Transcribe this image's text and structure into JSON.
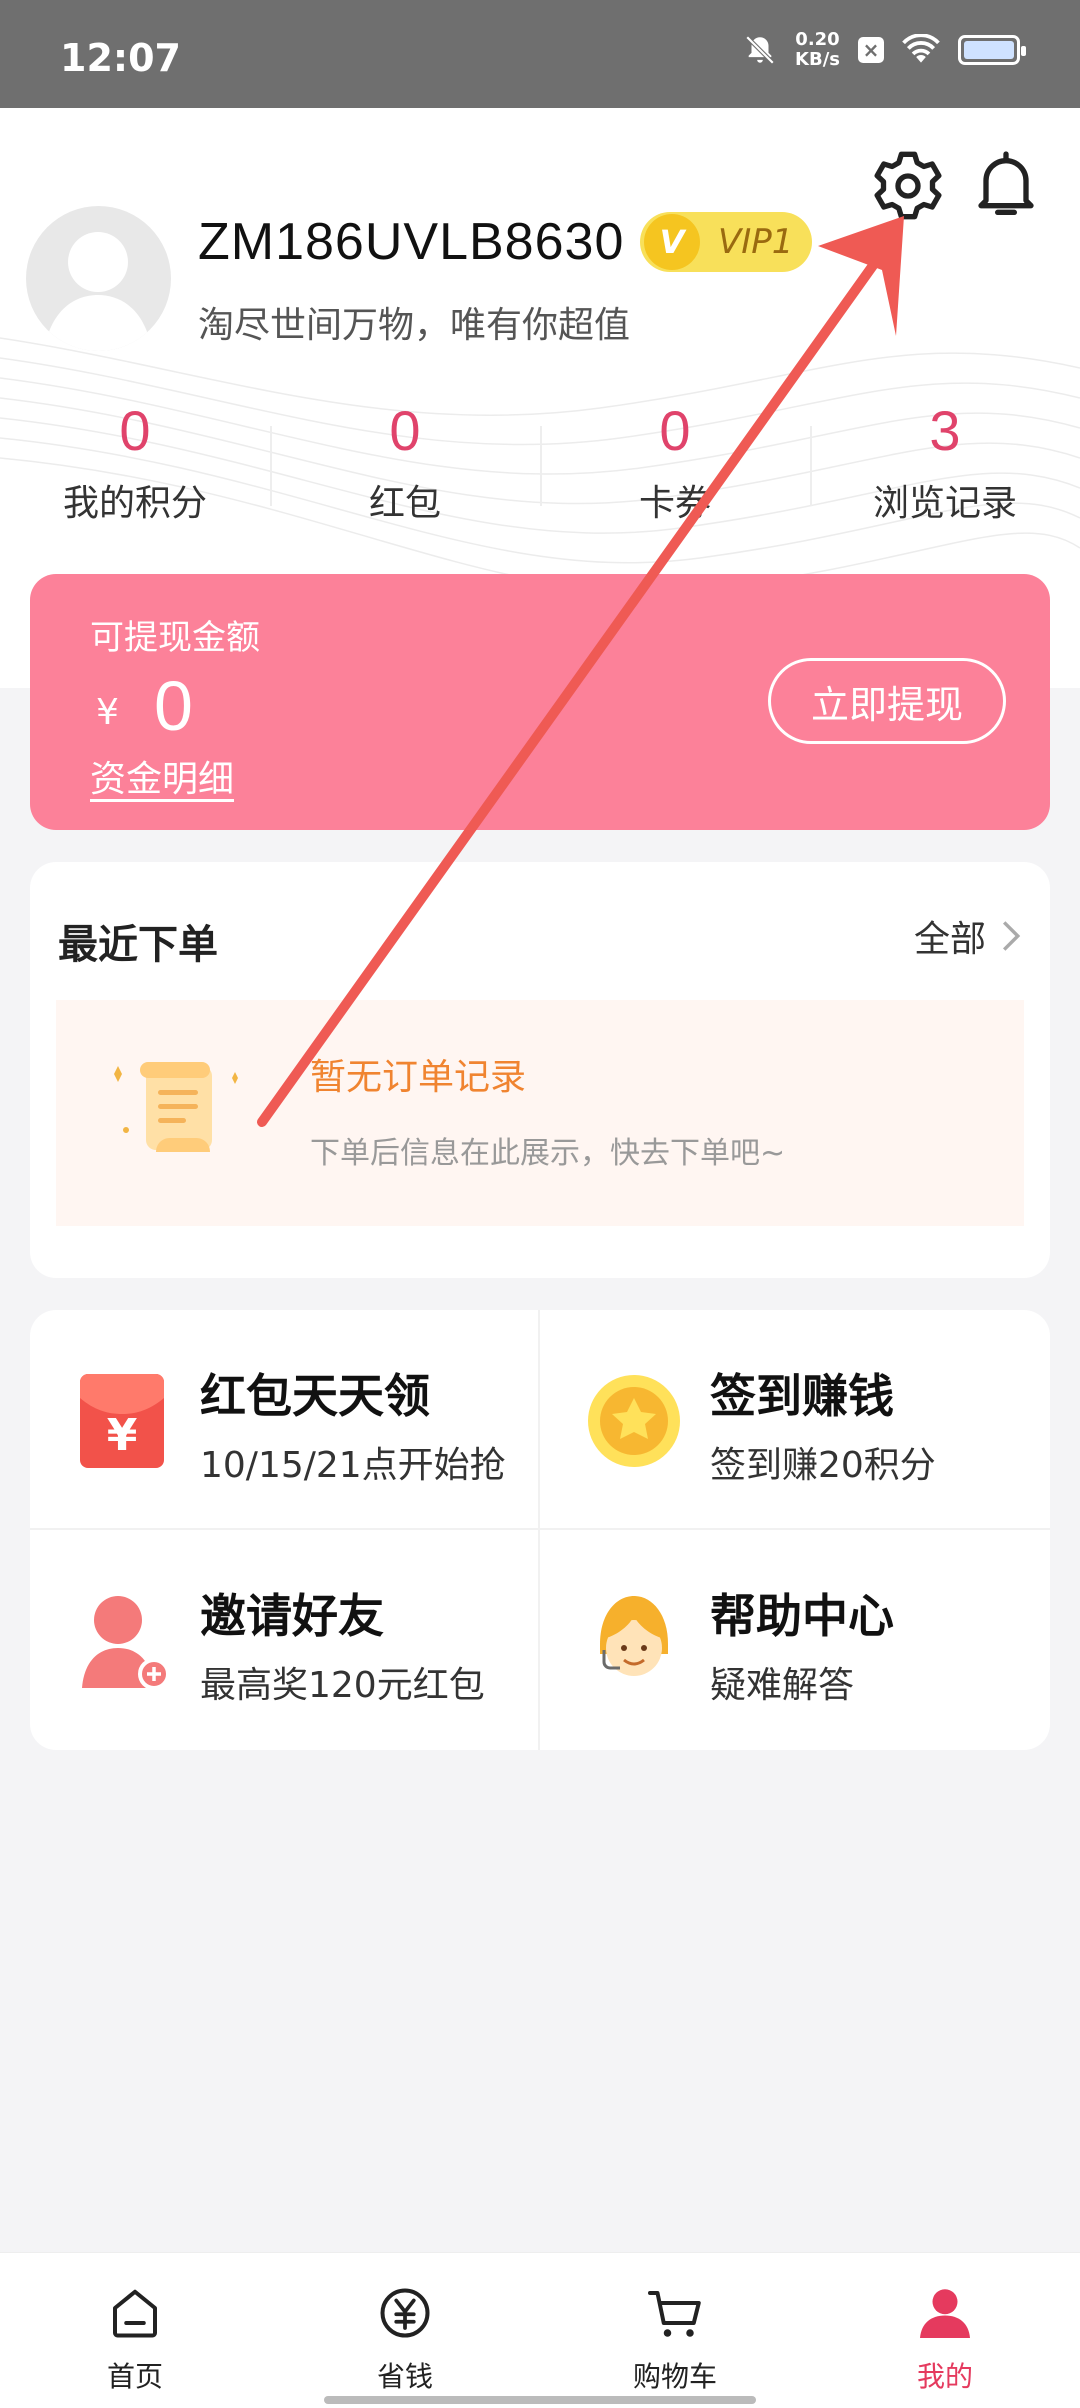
{
  "status_bar": {
    "time": "12:07",
    "net_speed_top": "0.20",
    "net_speed_bottom": "KB/s"
  },
  "profile": {
    "username": "ZM186UVLB8630",
    "vip_badge": "VIP1",
    "vip_letter": "V",
    "slogan": "淘尽世间万物，唯有你超值"
  },
  "stats": [
    {
      "value": "0",
      "label": "我的积分"
    },
    {
      "value": "0",
      "label": "红包"
    },
    {
      "value": "0",
      "label": "卡券"
    },
    {
      "value": "3",
      "label": "浏览记录"
    }
  ],
  "withdraw": {
    "title": "可提现金额",
    "currency": "¥",
    "amount": "0",
    "detail_link": "资金明细",
    "button": "立即提现"
  },
  "orders": {
    "title": "最近下单",
    "all_label": "全部",
    "empty_title": "暂无订单记录",
    "empty_sub": "下单后信息在此展示，快去下单吧~"
  },
  "services": [
    {
      "title": "红包天天领",
      "subtitle": "10/15/21点开始抢",
      "icon": "red-envelope-icon"
    },
    {
      "title": "签到赚钱",
      "subtitle": "签到赚20积分",
      "icon": "coin-star-icon"
    },
    {
      "title": "邀请好友",
      "subtitle": "最高奖120元红包",
      "icon": "invite-user-icon"
    },
    {
      "title": "帮助中心",
      "subtitle": "疑难解答",
      "icon": "customer-service-icon"
    }
  ],
  "tabs": [
    {
      "label": "首页",
      "icon": "home-icon"
    },
    {
      "label": "省钱",
      "icon": "yuan-coin-icon"
    },
    {
      "label": "购物车",
      "icon": "cart-icon"
    },
    {
      "label": "我的",
      "icon": "user-icon",
      "active": true
    }
  ],
  "colors": {
    "accent": "#e53a5e",
    "withdraw_card": "#fc8199",
    "vip_badge": "#f8e05a",
    "orange_text": "#f08430"
  }
}
